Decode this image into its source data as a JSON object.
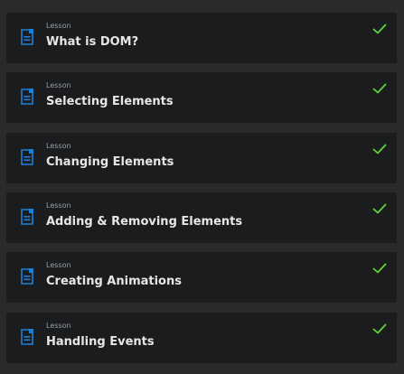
{
  "colors": {
    "page_background": "#282a2c",
    "card_background": "#1b1c1d",
    "icon_blue": "#1e7fd6",
    "check_green": "#62d23a"
  },
  "lessons": [
    {
      "kind": "Lesson",
      "title": "What is DOM?",
      "icon": "document-icon",
      "status_icon": "checkmark-icon"
    },
    {
      "kind": "Lesson",
      "title": "Selecting Elements",
      "icon": "document-icon",
      "status_icon": "checkmark-icon"
    },
    {
      "kind": "Lesson",
      "title": "Changing Elements",
      "icon": "document-icon",
      "status_icon": "checkmark-icon"
    },
    {
      "kind": "Lesson",
      "title": "Adding & Removing Elements",
      "icon": "document-icon",
      "status_icon": "checkmark-icon"
    },
    {
      "kind": "Lesson",
      "title": "Creating Animations",
      "icon": "document-icon",
      "status_icon": "checkmark-icon"
    },
    {
      "kind": "Lesson",
      "title": "Handling Events",
      "icon": "document-icon",
      "status_icon": "checkmark-icon"
    }
  ]
}
